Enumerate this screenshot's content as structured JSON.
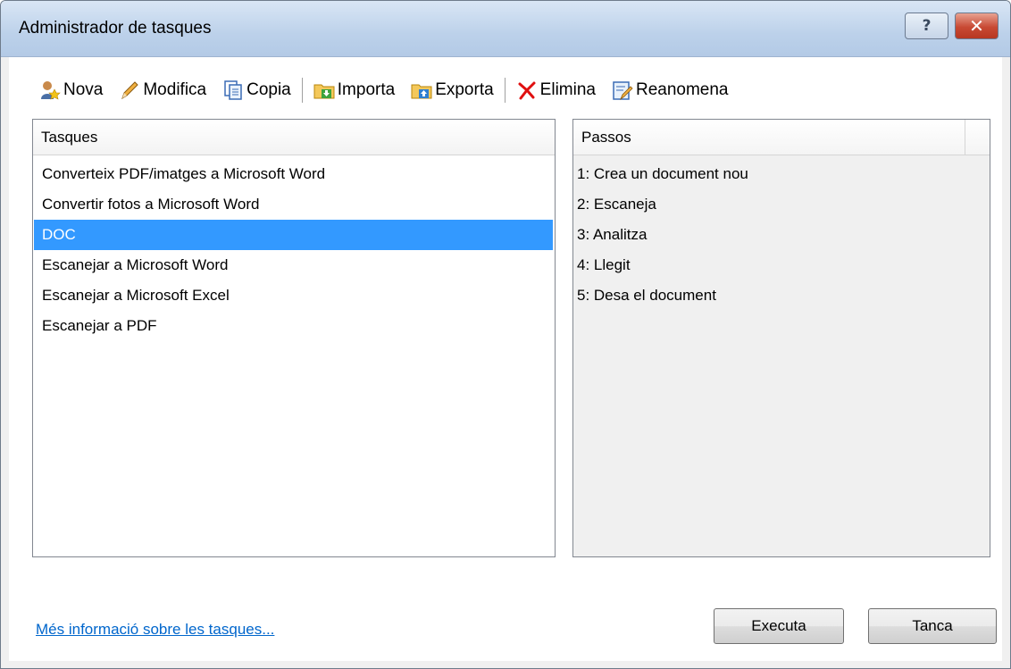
{
  "window": {
    "title": "Administrador de tasques",
    "help_label": "?",
    "close_label": "✕"
  },
  "toolbar": {
    "items": [
      {
        "label": "Nova",
        "icon": "new-task-icon"
      },
      {
        "label": "Modifica",
        "icon": "pencil-icon"
      },
      {
        "label": "Copia",
        "icon": "copy-icon"
      },
      {
        "label": "Importa",
        "icon": "import-folder-icon"
      },
      {
        "label": "Exporta",
        "icon": "export-folder-icon"
      },
      {
        "label": "Elimina",
        "icon": "delete-x-icon"
      },
      {
        "label": "Reanomena",
        "icon": "rename-icon"
      }
    ]
  },
  "tasks": {
    "header": "Tasques",
    "items": [
      "Converteix PDF/imatges a Microsoft Word",
      "Convertir fotos a Microsoft Word",
      "DOC",
      "Escanejar a Microsoft Word",
      "Escanejar a Microsoft Excel",
      "Escanejar a PDF"
    ],
    "selected_index": 2
  },
  "steps": {
    "header": "Passos",
    "items": [
      "1: Crea un document nou",
      "2: Escaneja",
      "3: Analitza",
      "4: Llegit",
      "5: Desa el document"
    ]
  },
  "footer": {
    "link": "Més informació sobre les tasques...",
    "run_label": "Executa",
    "close_label": "Tanca"
  },
  "colors": {
    "selection": "#3399ff",
    "link": "#0066cc",
    "delete": "#e01010"
  }
}
